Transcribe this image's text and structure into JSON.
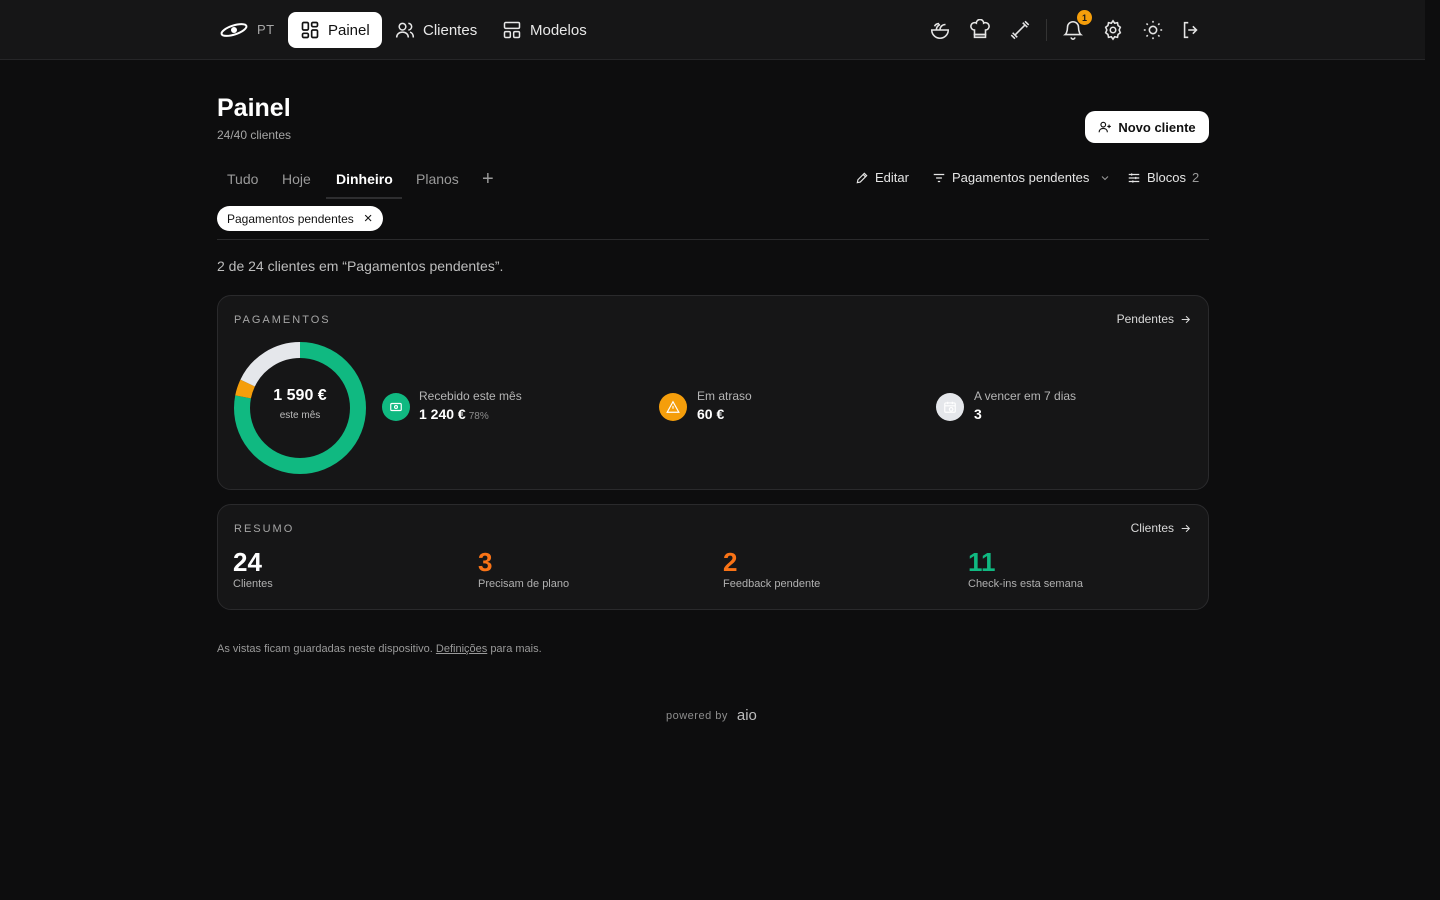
{
  "topbar": {
    "lang": "PT",
    "nav": [
      {
        "label": "Painel",
        "icon": "dashboard-icon",
        "active": true
      },
      {
        "label": "Clientes",
        "icon": "users-icon",
        "active": false
      },
      {
        "label": "Modelos",
        "icon": "templates-icon",
        "active": false
      }
    ],
    "icons": [
      "salad-icon",
      "chef-hat-icon",
      "dumbbell-icon",
      "bell-icon",
      "gear-icon",
      "sun-icon",
      "logout-icon"
    ],
    "notifications_count": "1"
  },
  "page": {
    "title": "Painel",
    "subtitle": "24/40 clientes",
    "new_client_label": "Novo cliente"
  },
  "tabs": [
    {
      "label": "Tudo",
      "active": false
    },
    {
      "label": "Hoje",
      "active": false
    },
    {
      "label": "Dinheiro",
      "active": true
    },
    {
      "label": "Planos",
      "active": false
    }
  ],
  "tab_add": "+",
  "toolbar": {
    "edit_label": "Editar",
    "filter_label": "Pagamentos pendentes",
    "blocks_label": "Blocos",
    "blocks_count": "2"
  },
  "filter_chip": {
    "label": "Pagamentos pendentes",
    "close": "×"
  },
  "result_text": "2 de 24 clientes em “Pagamentos pendentes”.",
  "payments": {
    "label": "PAGAMENTOS",
    "link": "Pendentes",
    "total_value": "1 590 €",
    "total_label": "este mês",
    "received": {
      "label": "Recebido este mês",
      "value": "1 240 €",
      "pct": "78%",
      "color": "#10b981",
      "icon": "money-icon"
    },
    "overdue": {
      "label": "Em atraso",
      "value": "60 €",
      "color": "#f59e0b",
      "icon": "warning-icon"
    },
    "due_soon": {
      "label": "A vencer em 7 dias",
      "value": "3",
      "color": "#e5e7eb",
      "icon": "calendar-clock-icon"
    },
    "donut": {
      "received_fraction": 0.78,
      "overdue_fraction": 0.04,
      "pending_fraction": 0.18
    }
  },
  "summary": {
    "label": "RESUMO",
    "link": "Clientes",
    "items": [
      {
        "value": "24",
        "label": "Clientes",
        "color": "#ffffff"
      },
      {
        "value": "3",
        "label": "Precisam de plano",
        "color": "#f97316"
      },
      {
        "value": "2",
        "label": "Feedback pendente",
        "color": "#f97316"
      },
      {
        "value": "11",
        "label": "Check-ins esta semana",
        "color": "#10b981"
      }
    ]
  },
  "footnote": {
    "before": "As vistas ficam guardadas neste dispositivo.",
    "link": "Definições",
    "after": "para mais."
  },
  "powered": {
    "label": "powered by",
    "brand": "aio"
  }
}
